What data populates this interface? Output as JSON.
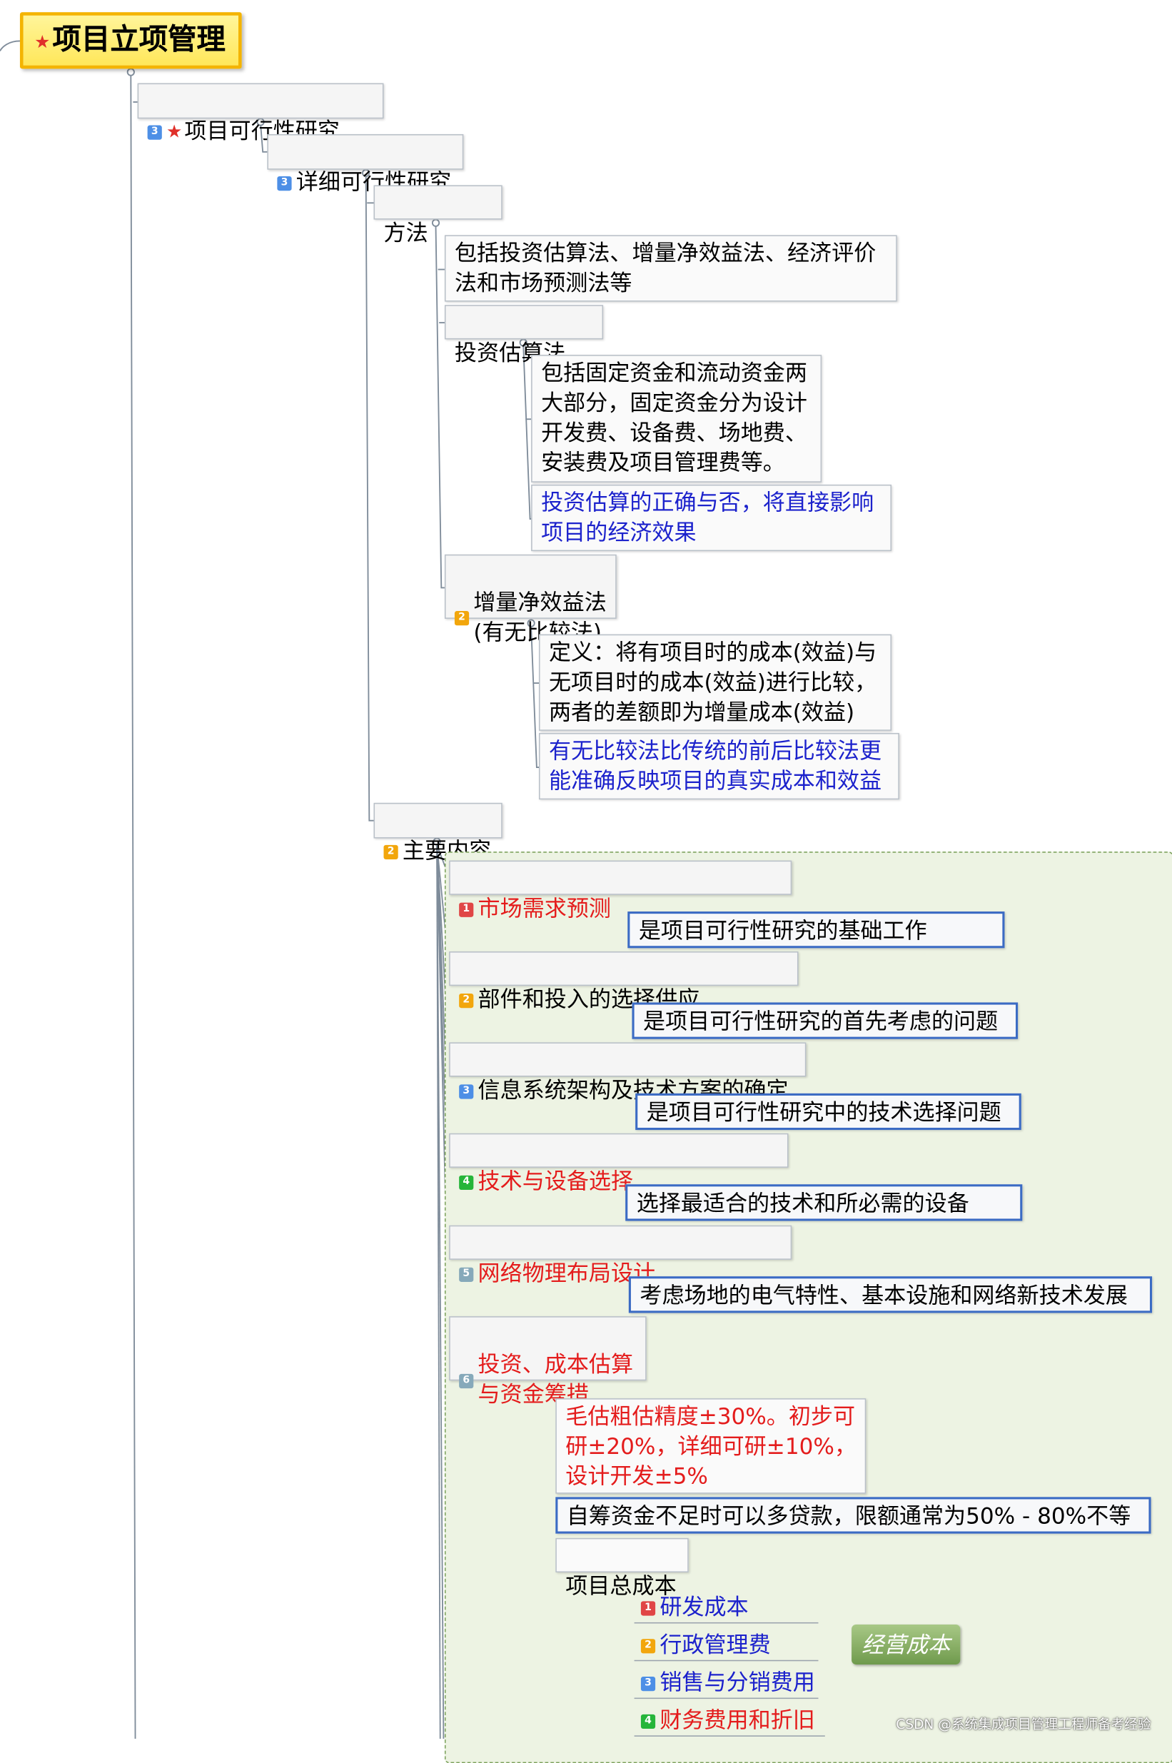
{
  "root": {
    "label": "项目立项管理",
    "icon": "star-icon"
  },
  "feasibility": {
    "badge": "3",
    "label": "项目可行性研究",
    "icon": "star-icon"
  },
  "detailed": {
    "badge": "3",
    "label": "详细可行性研究"
  },
  "method": {
    "label": "方法",
    "summary": "包括投资估算法、增量净效益法、经济评价\n法和市场预测法等",
    "investment": {
      "label": "投资估算法",
      "desc": "包括固定资金和流动资金两\n大部分，固定资金分为设计\n开发费、设备费、场地费、\n安装费及项目管理费等。",
      "note": "投资估算的正确与否，将直接影响\n项目的经济效果"
    },
    "incremental": {
      "badge": "2",
      "label": "增量净效益法\n(有无比较法)",
      "desc": "定义：将有项目时的成本(效益)与\n无项目时的成本(效益)进行比较，\n两者的差额即为增量成本(效益)",
      "note": "有无比较法比传统的前后比较法更\n能准确反映项目的真实成本和效益"
    }
  },
  "main_content": {
    "badge": "2",
    "label": "主要内容",
    "items": [
      {
        "badge": "1",
        "label": "市场需求预测",
        "detail": "是项目可行性研究的基础工作"
      },
      {
        "badge": "2",
        "label": "部件和投入的选择供应",
        "detail": "是项目可行性研究的首先考虑的问题"
      },
      {
        "badge": "3",
        "label": "信息系统架构及技术方案的确定",
        "detail": "是项目可行性研究中的技术选择问题"
      },
      {
        "badge": "4",
        "label": "技术与设备选择",
        "detail": "选择最适合的技术和所必需的设备"
      },
      {
        "badge": "5",
        "label": "网络物理布局设计",
        "detail": "考虑场地的电气特性、基本设施和网络新技术发展"
      },
      {
        "badge": "6",
        "label": "投资、成本估算\n与资金筹措"
      }
    ],
    "estimation": {
      "accuracy": "毛估粗估精度±30%。初步可\n研±20%，详细可研±10%，\n设计开发±5%",
      "funding": "自筹资金不足时可以多贷款，限额通常为50% - 80%不等",
      "total_cost": {
        "label": "项目总成本",
        "items": [
          {
            "badge": "1",
            "label": "研发成本"
          },
          {
            "badge": "2",
            "label": "行政管理费"
          },
          {
            "badge": "3",
            "label": "销售与分销费用"
          },
          {
            "badge": "4",
            "label": "财务费用和折旧"
          }
        ],
        "group_label": "经营成本"
      }
    }
  },
  "watermark": "CSDN @系统集成项目管理工程师备考经验"
}
